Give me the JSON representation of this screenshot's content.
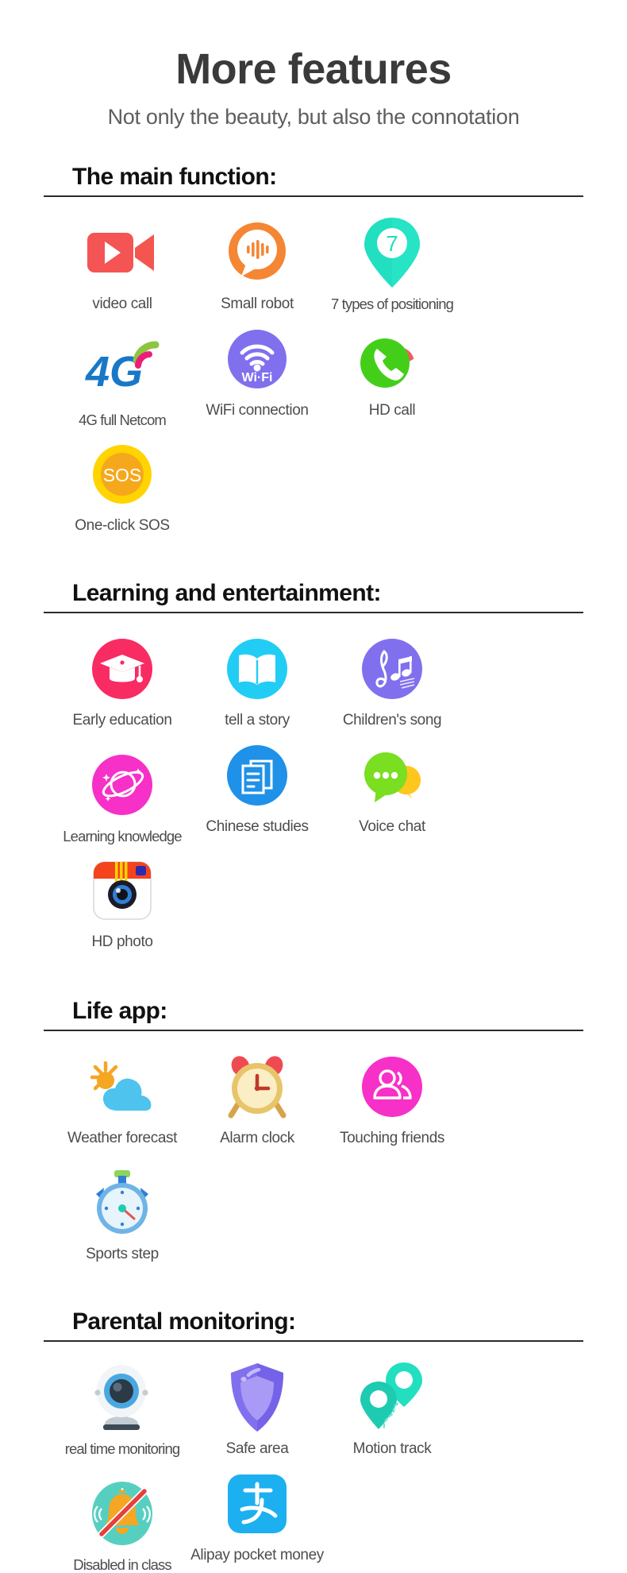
{
  "hero": {
    "title": "More features",
    "subtitle": "Not only the beauty, but also the connotation"
  },
  "colors": {
    "video_red": "#f45454",
    "robot_orange": "#f58634",
    "locate_teal": "#22dfc0",
    "net_blue": "#1878c8",
    "net_green": "#8cc63f",
    "net_magenta": "#ec1d7a",
    "wifi_purple": "#8070ee",
    "call_green": "#43cf19",
    "call_red": "#f45b5b",
    "sos_yellow": "#ffd400",
    "sos_orange": "#f5a81c",
    "edu_pink": "#f92b63",
    "story_cyan": "#21cdf5",
    "song_purple": "#8070ee",
    "knowledge_magenta": "#f730c8",
    "chinese_blue": "#1f91e8",
    "voice_green": "#7ade21",
    "voice_yellow": "#ffc61e",
    "photo_red": "#f4441e",
    "weather_blue": "#4ec3ee",
    "weather_sun": "#f5a623",
    "alarm_cream": "#fbeec4",
    "alarm_gold": "#e8c46a",
    "friends_magenta": "#f730c8",
    "step_blue": "#3d8fd8",
    "cam_blue": "#4aa8e0",
    "shield_purple": "#8070ee",
    "track_teal": "#1ecbb0",
    "bell_teal": "#56cfc0",
    "bell_orange": "#f5a623",
    "alipay_blue": "#1cb0f0",
    "rule_dark": "#2b2b2b",
    "title_dark": "#3a3a3a",
    "caption_gray": "#4d4d4d"
  },
  "sections": [
    {
      "id": "main-function",
      "title": "The main function:",
      "items": [
        {
          "label": "video call",
          "icon": "video-camera-icon"
        },
        {
          "label": "Small robot",
          "icon": "voice-bubble-icon"
        },
        {
          "label": "7 types of positioning",
          "icon": "location-pin-7-icon"
        },
        {
          "label": "4G full Netcom",
          "icon": "4g-signal-icon"
        },
        {
          "label": "WiFi connection",
          "icon": "wifi-icon"
        },
        {
          "label": "HD call",
          "icon": "phone-call-icon"
        },
        {
          "label": "One-click SOS",
          "icon": "sos-icon"
        }
      ]
    },
    {
      "id": "learning-entertainment",
      "title": "Learning and entertainment:",
      "items": [
        {
          "label": "Early education",
          "icon": "graduation-cap-icon"
        },
        {
          "label": "tell a story",
          "icon": "open-book-icon"
        },
        {
          "label": "Children's song",
          "icon": "music-notes-icon"
        },
        {
          "label": "Learning knowledge",
          "icon": "planet-icon"
        },
        {
          "label": "Chinese studies",
          "icon": "document-icon"
        },
        {
          "label": "Voice chat",
          "icon": "chat-bubbles-icon"
        },
        {
          "label": "HD photo",
          "icon": "camera-app-icon"
        }
      ]
    },
    {
      "id": "life-app",
      "title": "Life app:",
      "items": [
        {
          "label": "Weather forecast",
          "icon": "sun-cloud-icon"
        },
        {
          "label": "Alarm clock",
          "icon": "alarm-clock-icon"
        },
        {
          "label": "Touching friends",
          "icon": "two-people-icon"
        },
        {
          "label": "Sports step",
          "icon": "stopwatch-icon"
        }
      ]
    },
    {
      "id": "parental-monitoring",
      "title": "Parental monitoring:",
      "items": [
        {
          "label": "real time monitoring",
          "icon": "webcam-icon"
        },
        {
          "label": "Safe area",
          "icon": "shield-icon"
        },
        {
          "label": "Motion track",
          "icon": "motion-track-icon"
        },
        {
          "label": "Disabled in class",
          "icon": "bell-disabled-icon"
        },
        {
          "label": "Alipay pocket money",
          "icon": "alipay-icon"
        }
      ]
    }
  ]
}
